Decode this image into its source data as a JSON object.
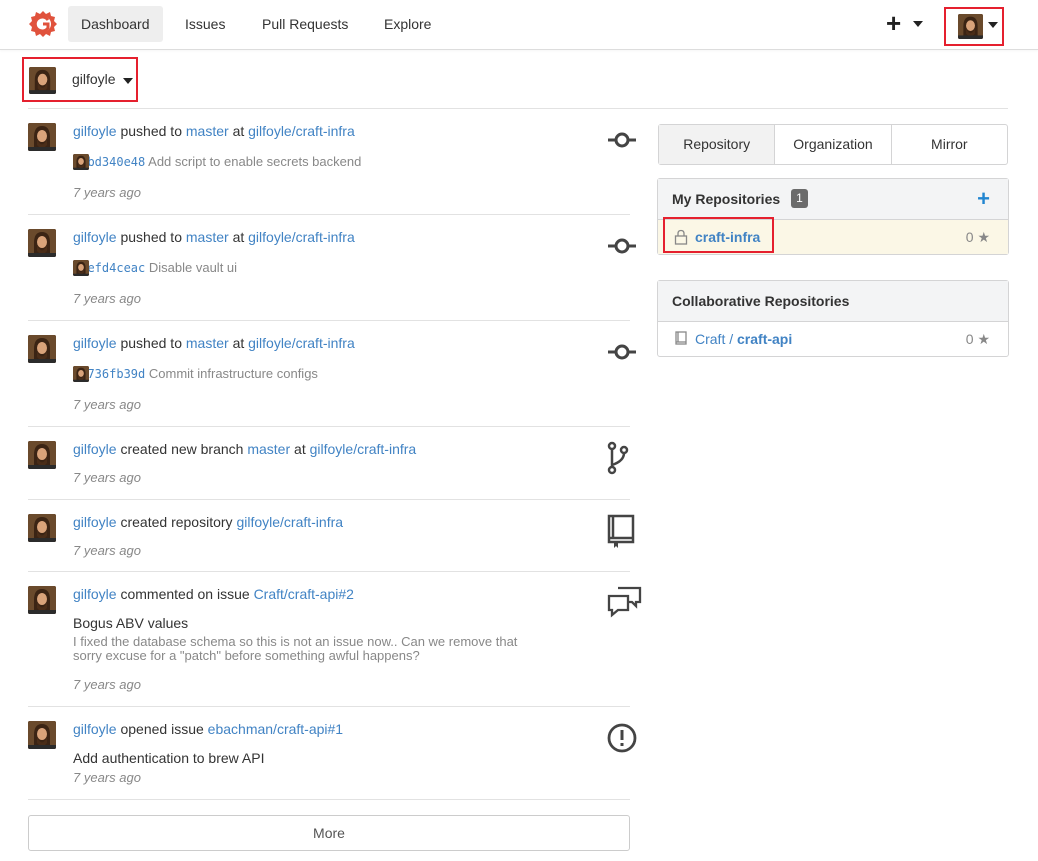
{
  "nav": {
    "items": [
      "Dashboard",
      "Issues",
      "Pull Requests",
      "Explore"
    ],
    "plus": "+"
  },
  "context": {
    "user": "gilfoyle"
  },
  "feed": [
    {
      "user": "gilfoyle",
      "action": "pushed to",
      "ref": "master",
      "conj": "at",
      "repo": "gilfoyle/craft-infra",
      "sha": "72bd340e48",
      "message": "Add script to enable secrets backend",
      "time": "7 years ago",
      "icon": "commit-icon"
    },
    {
      "user": "gilfoyle",
      "action": "pushed to",
      "ref": "master",
      "conj": "at",
      "repo": "gilfoyle/craft-infra",
      "sha": "a7efd4ceac",
      "message": "Disable vault ui",
      "time": "7 years ago",
      "icon": "commit-icon"
    },
    {
      "user": "gilfoyle",
      "action": "pushed to",
      "ref": "master",
      "conj": "at",
      "repo": "gilfoyle/craft-infra",
      "sha": "84736fb39d",
      "message": "Commit infrastructure configs",
      "time": "7 years ago",
      "icon": "commit-icon"
    },
    {
      "user": "gilfoyle",
      "action": "created new branch",
      "ref": "master",
      "conj": "at",
      "repo": "gilfoyle/craft-infra",
      "time": "7 years ago",
      "icon": "git-branch-icon"
    },
    {
      "user": "gilfoyle",
      "action": "created repository",
      "repo": "gilfoyle/craft-infra",
      "time": "7 years ago",
      "icon": "repo-icon"
    },
    {
      "user": "gilfoyle",
      "action": "commented on issue",
      "repo": "Craft/craft-api#2",
      "issue_title": "Bogus ABV values",
      "comment_line1": "I fixed the database schema so this is not an issue now.. Can we remove that",
      "comment_line2": "sorry excuse for a \"patch\" before something awful happens?",
      "time": "7 years ago",
      "icon": "comment-discussion-icon"
    },
    {
      "user": "gilfoyle",
      "action": "opened issue",
      "repo": "ebachman/craft-api#1",
      "issue_title": "Add authentication to brew API",
      "time": "7 years ago",
      "icon": "issue-opened-icon"
    }
  ],
  "more_label": "More",
  "tabs": [
    "Repository",
    "Organization",
    "Mirror"
  ],
  "my_repos": {
    "title": "My Repositories",
    "count": "1",
    "add": "+",
    "items": [
      {
        "name": "craft-infra",
        "stars": "0",
        "private": true
      }
    ]
  },
  "collab_repos": {
    "title": "Collaborative Repositories",
    "items": [
      {
        "owner": "Craft",
        "sep": " / ",
        "name": "craft-api",
        "stars": "0"
      }
    ]
  },
  "colors": {
    "accent": "#4183c4",
    "highlight_box": "#e5202e",
    "logo": "#e0523c"
  }
}
